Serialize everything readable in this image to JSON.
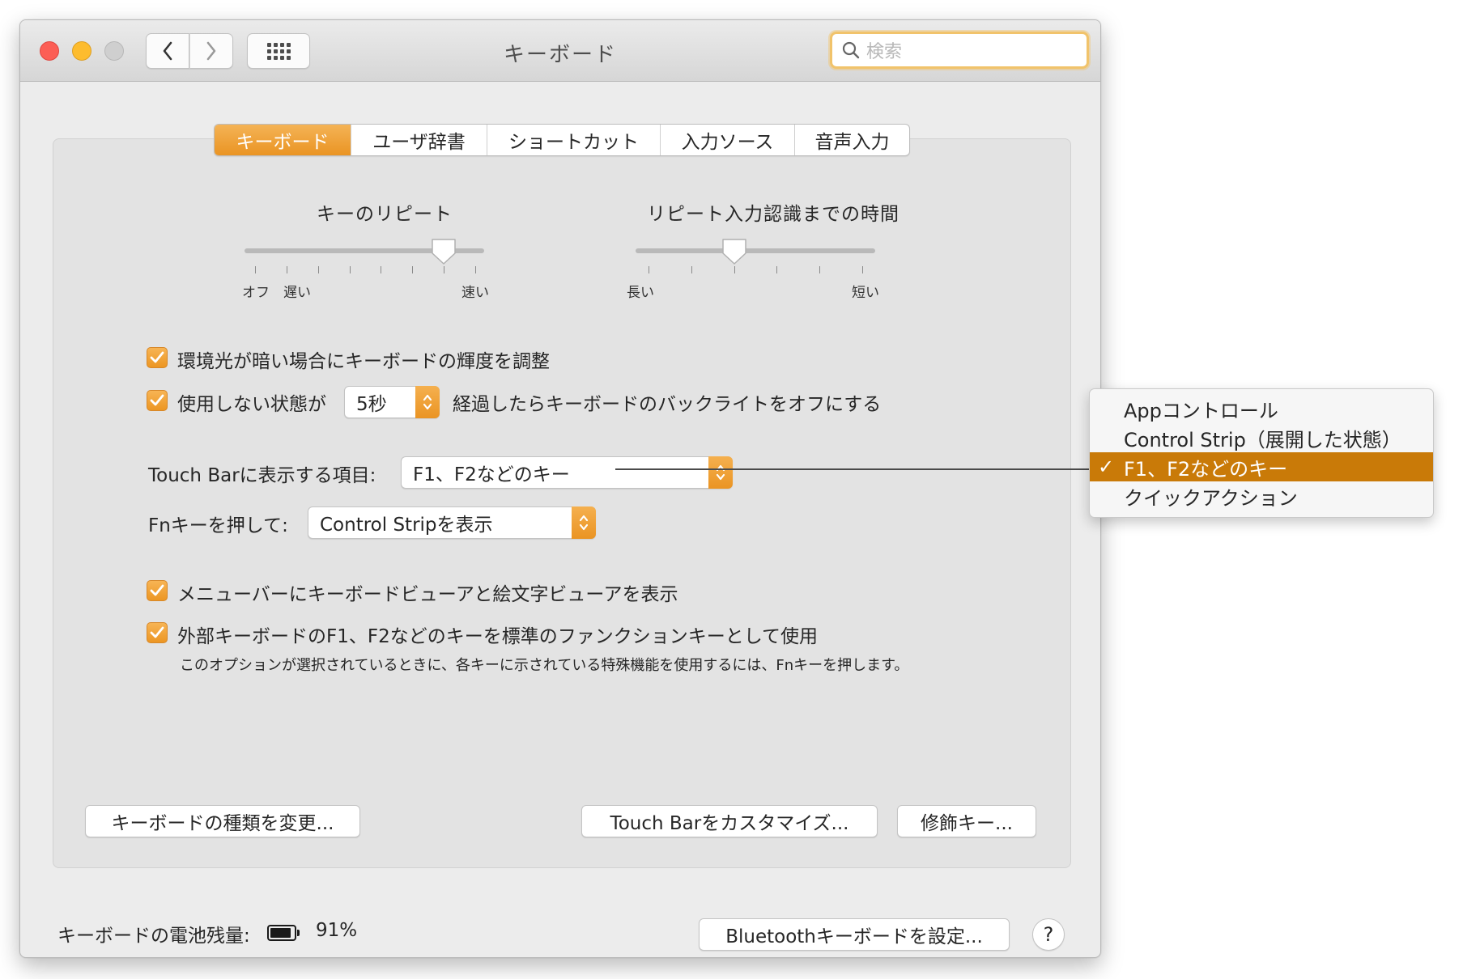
{
  "window": {
    "title": "キーボード"
  },
  "search": {
    "placeholder": "検索"
  },
  "tabs": [
    {
      "label": "キーボード",
      "active": true
    },
    {
      "label": "ユーザ辞書",
      "active": false
    },
    {
      "label": "ショートカット",
      "active": false
    },
    {
      "label": "入力ソース",
      "active": false
    },
    {
      "label": "音声入力",
      "active": false
    }
  ],
  "key_repeat": {
    "label": "キーのリピート",
    "left_label": "オフ",
    "left2_label": "遅い",
    "right_label": "速い",
    "position_step": 6,
    "steps": 8
  },
  "delay_until_repeat": {
    "label": "リピート入力認識までの時間",
    "left_label": "長い",
    "right_label": "短い",
    "position_step": 2,
    "steps": 6
  },
  "options": {
    "adjust_brightness": {
      "label": "環境光が暗い場合にキーボードの輝度を調整",
      "checked": true
    },
    "backlight_off": {
      "label_before": "使用しない状態が",
      "value": "5秒",
      "label_after": "経過したらキーボードのバックライトをオフにする",
      "checked": true
    },
    "touch_bar": {
      "label": "Touch Barに表示する項目:",
      "value": "F1、F2などのキー"
    },
    "fn_key": {
      "label": "Fnキーを押して:",
      "value": "Control Stripを表示"
    },
    "show_viewers": {
      "label": "メニューバーにキーボードビューアと絵文字ビューアを表示",
      "checked": true
    },
    "standard_fkeys": {
      "label": "外部キーボードのF1、F2などのキーを標準のファンクションキーとして使用",
      "note": "このオプションが選択されているときに、各キーに示されている特殊機能を使用するには、Fnキーを押します。",
      "checked": true
    }
  },
  "buttons": {
    "change_type": "キーボードの種類を変更...",
    "customize_touchbar": "Touch Barをカスタマイズ...",
    "modifier_keys": "修飾キー...",
    "bluetooth_setup": "Bluetoothキーボードを設定...",
    "help": "?"
  },
  "battery": {
    "label": "キーボードの電池残量:",
    "percent_text": "91%",
    "level": 0.91
  },
  "touchbar_menu": {
    "items": [
      {
        "label": "Appコントロール",
        "selected": false
      },
      {
        "label": "Control Strip（展開した状態）",
        "selected": false
      },
      {
        "label": "F1、F2などのキー",
        "selected": true
      },
      {
        "label": "クイックアクション",
        "selected": false
      }
    ],
    "check_glyph": "✓"
  },
  "colors": {
    "accent": "#ea9423",
    "menu_highlight": "#c97a08"
  }
}
